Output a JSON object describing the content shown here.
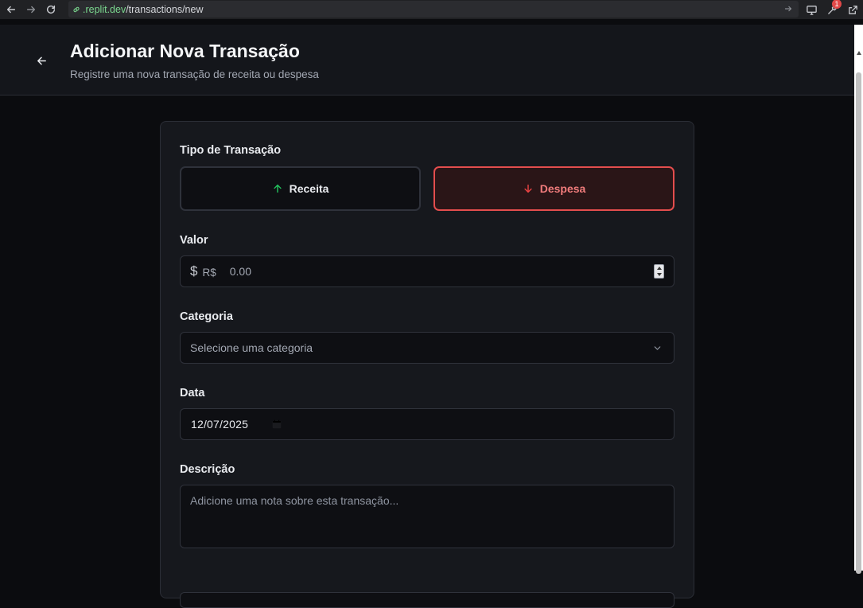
{
  "browser": {
    "url_host": ".replit.dev",
    "url_path": "/transactions/new",
    "notification_count": "1"
  },
  "header": {
    "title": "Adicionar Nova Transação",
    "subtitle": "Registre uma nova transação de receita ou despesa"
  },
  "form": {
    "type_label": "Tipo de Transação",
    "type_options": [
      {
        "label": "Receita",
        "icon": "arrow-up-icon",
        "color": "#22c55e",
        "selected": false
      },
      {
        "label": "Despesa",
        "icon": "arrow-down-icon",
        "color": "#ef4444",
        "selected": true
      }
    ],
    "valor_label": "Valor",
    "valor_currency": "R$",
    "valor_placeholder": "0.00",
    "categoria_label": "Categoria",
    "categoria_placeholder": "Selecione uma categoria",
    "data_label": "Data",
    "data_value": "12/07/2025",
    "descricao_label": "Descrição",
    "descricao_placeholder": "Adicione uma nota sobre esta transação..."
  }
}
